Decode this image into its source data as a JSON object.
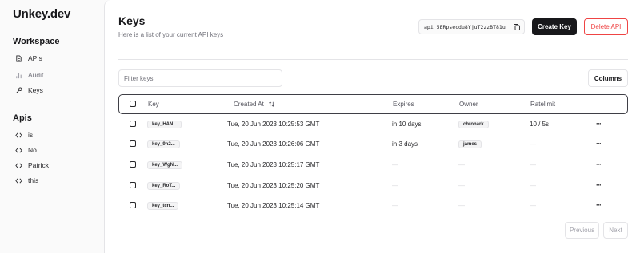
{
  "app": {
    "brand": "Unkey.dev"
  },
  "sidebar": {
    "workspace_title": "Workspace",
    "workspace_items": [
      {
        "label": "APIs",
        "icon": "file-icon"
      },
      {
        "label": "Audit",
        "icon": "bar-chart-icon"
      },
      {
        "label": "Keys",
        "icon": "key-icon"
      }
    ],
    "apis_title": "Apis",
    "api_items": [
      {
        "label": "is",
        "icon": "code-icon"
      },
      {
        "label": "No",
        "icon": "code-icon"
      },
      {
        "label": "Patrick",
        "icon": "code-icon"
      },
      {
        "label": "this",
        "icon": "code-icon"
      }
    ]
  },
  "header": {
    "title": "Keys",
    "subtitle": "Here is a list of your current API keys",
    "api_id": "api_5ERpsecdu8YjuT2zzBT81u",
    "create_label": "Create Key",
    "delete_label": "Delete API"
  },
  "toolbar": {
    "filter_placeholder": "Filter keys",
    "columns_label": "Columns"
  },
  "table": {
    "headers": {
      "key": "Key",
      "created": "Created At",
      "expires": "Expires",
      "owner": "Owner",
      "ratelimit": "Ratelimit"
    },
    "rows": [
      {
        "key": "key_HAN...",
        "created": "Tue, 20 Jun 2023 10:25:53 GMT",
        "expires": "in 10 days",
        "owner": "chronark",
        "ratelimit": "10 / 5s"
      },
      {
        "key": "key_9n2...",
        "created": "Tue, 20 Jun 2023 10:26:06 GMT",
        "expires": "in 3 days",
        "owner": "james",
        "ratelimit": "—"
      },
      {
        "key": "key_WgN...",
        "created": "Tue, 20 Jun 2023 10:25:17 GMT",
        "expires": "—",
        "owner": "—",
        "ratelimit": "—"
      },
      {
        "key": "key_RoT...",
        "created": "Tue, 20 Jun 2023 10:25:20 GMT",
        "expires": "—",
        "owner": "—",
        "ratelimit": "—"
      },
      {
        "key": "key_tcn...",
        "created": "Tue, 20 Jun 2023 10:25:14 GMT",
        "expires": "—",
        "owner": "—",
        "ratelimit": "—"
      }
    ],
    "more_glyph": "···"
  },
  "pagination": {
    "previous_label": "Previous",
    "next_label": "Next"
  }
}
